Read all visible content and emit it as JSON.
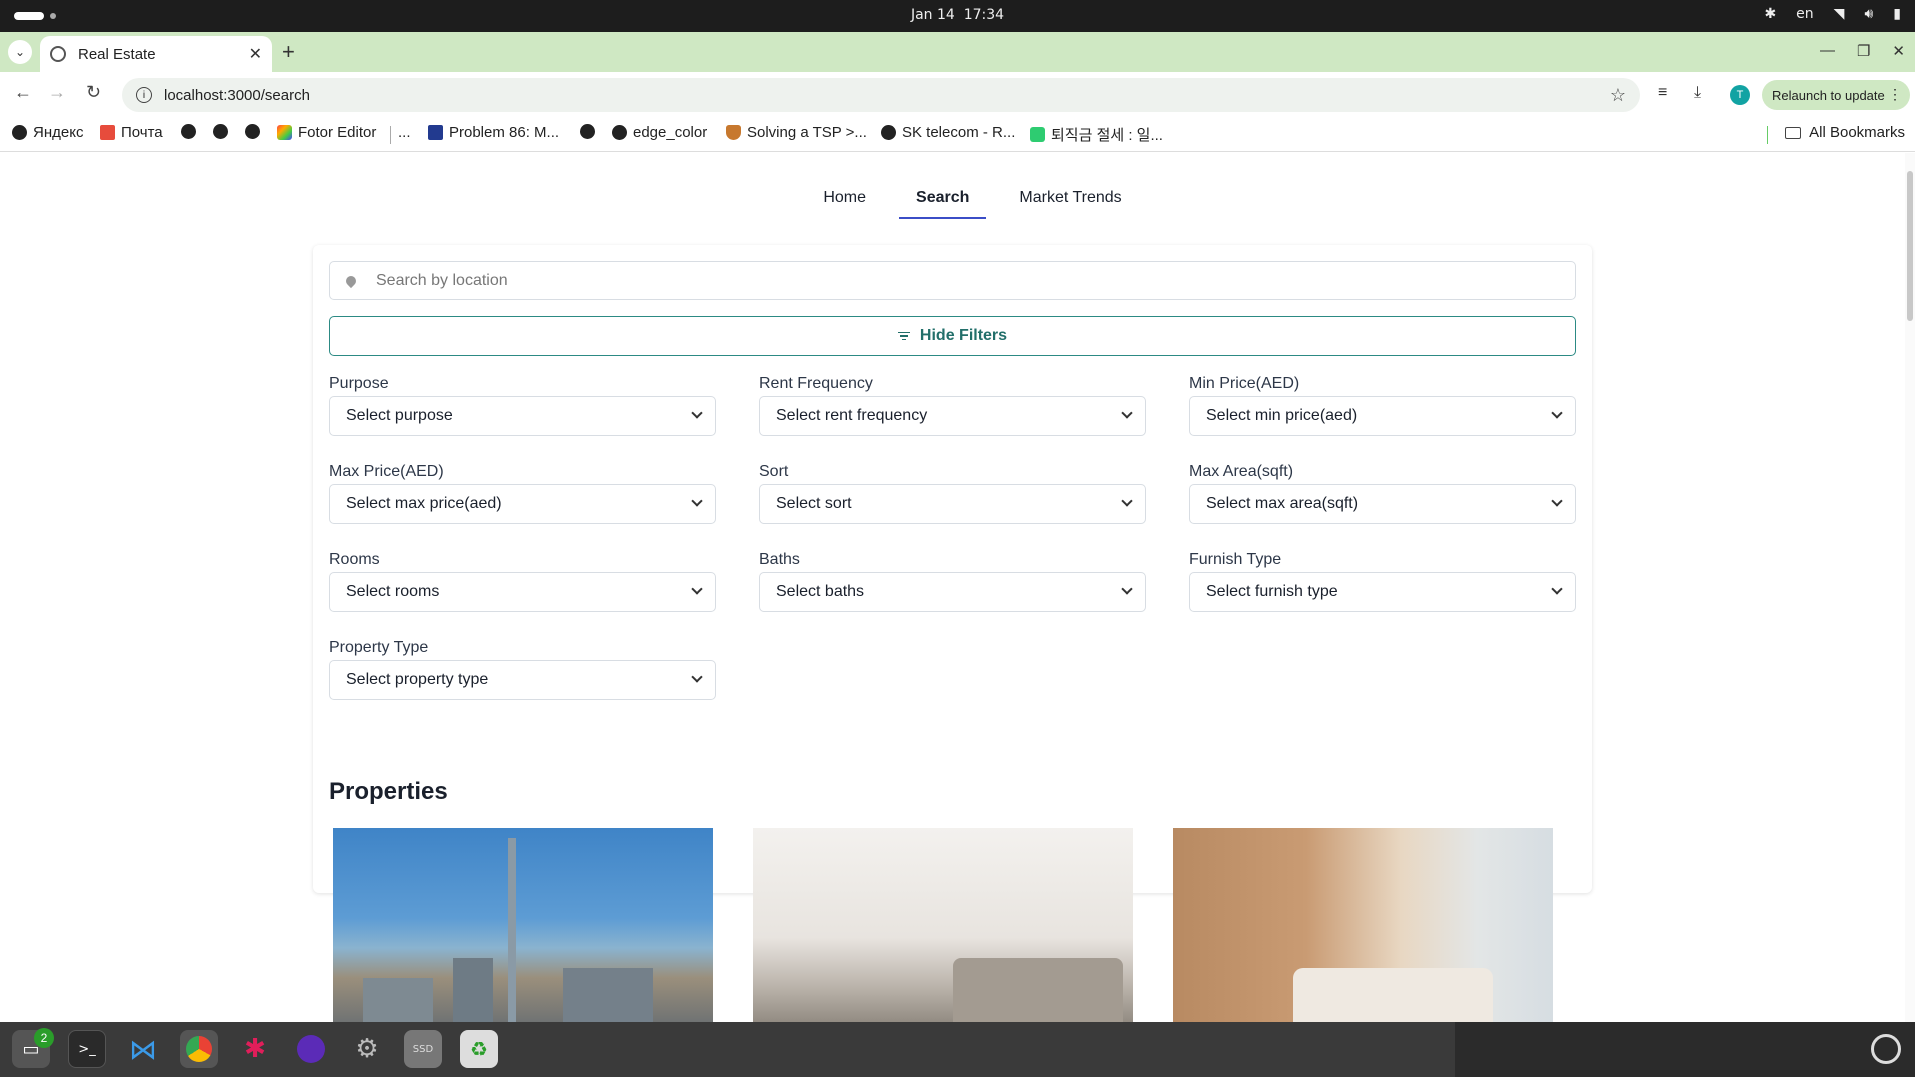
{
  "os": {
    "clock_date": "Jan 14",
    "clock_time": "17:34",
    "lang": "en"
  },
  "browser": {
    "tab_title": "Real Estate",
    "url": "localhost:3000/search",
    "profile_initial": "T",
    "relaunch_label": "Relaunch to update"
  },
  "bookmarks": {
    "items": [
      "Яндекс",
      "Почта",
      "",
      "",
      "",
      "Fotor Editor",
      "...",
      "Problem 86: M...",
      "",
      "edge_color",
      "Solving a TSP >...",
      "SK telecom - R...",
      "퇴직금 절세 : 일..."
    ],
    "all_label": "All Bookmarks"
  },
  "site": {
    "nav": [
      "Home",
      "Search",
      "Market Trends"
    ],
    "active_nav": "Search",
    "search_placeholder": "Search by location",
    "hide_filters_label": "Hide Filters",
    "filters": [
      {
        "label": "Purpose",
        "value": "Select purpose"
      },
      {
        "label": "Rent Frequency",
        "value": "Select rent frequency"
      },
      {
        "label": "Min Price(AED)",
        "value": "Select min price(aed)"
      },
      {
        "label": "Max Price(AED)",
        "value": "Select max price(aed)"
      },
      {
        "label": "Sort",
        "value": "Select sort"
      },
      {
        "label": "Max Area(sqft)",
        "value": "Select max area(sqft)"
      },
      {
        "label": "Rooms",
        "value": "Select rooms"
      },
      {
        "label": "Baths",
        "value": "Select baths"
      },
      {
        "label": "Furnish Type",
        "value": "Select furnish type"
      },
      {
        "label": "Property Type",
        "value": "Select property type"
      }
    ],
    "properties_heading": "Properties"
  },
  "dock": {
    "files_badge": "2"
  },
  "colors": {
    "accent": "#226f6a",
    "nav_underline": "#3b4dc7",
    "tabstrip": "#cfe8c3"
  }
}
